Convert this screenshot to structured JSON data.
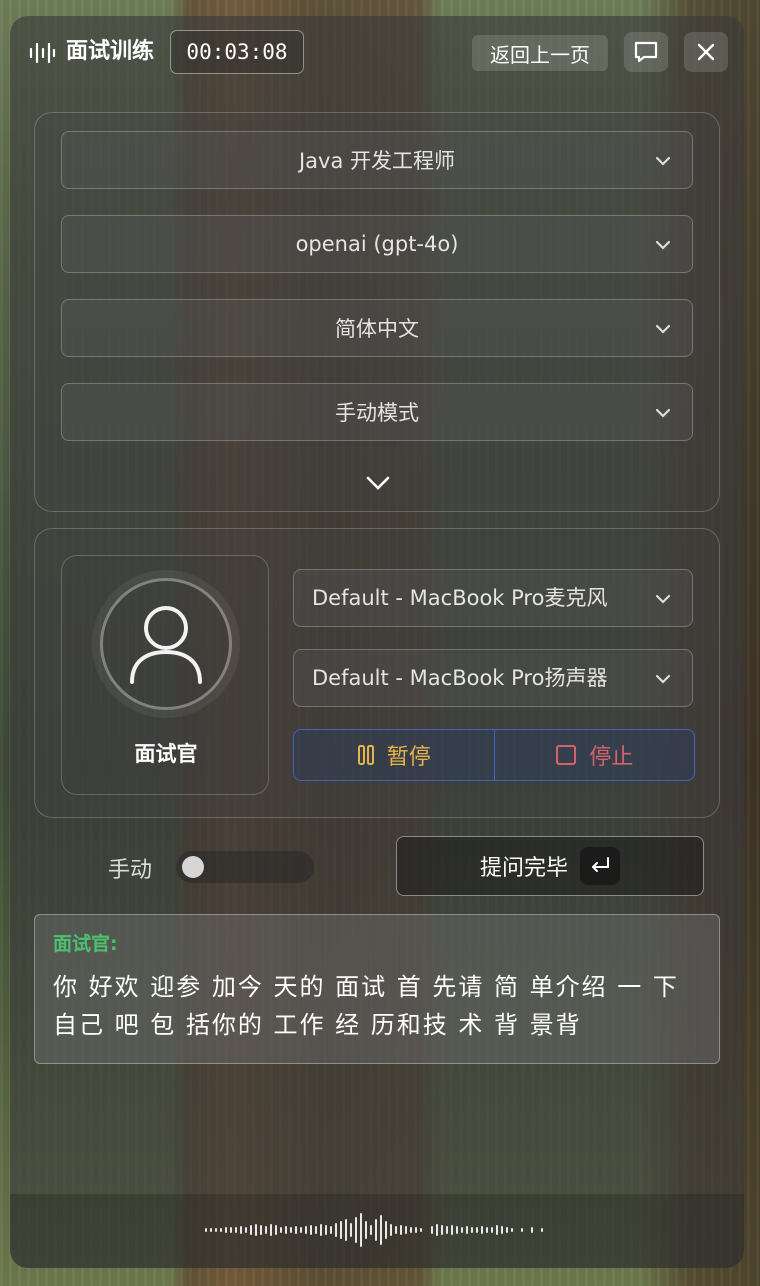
{
  "header": {
    "title": "面试训练",
    "timer": "00:03:08",
    "back_label": "返回上一页",
    "icons": {
      "logo": "waveform-icon",
      "chat": "chat-icon",
      "close": "close-icon"
    }
  },
  "settings": {
    "position": "Java 开发工程师",
    "model": "openai (gpt-4o)",
    "language": "简体中文",
    "mode": "手动模式"
  },
  "devices": {
    "avatar_label": "面试官",
    "microphone": "Default - MacBook Pro麦克风",
    "speaker": "Default - MacBook Pro扬声器",
    "pause_label": "暂停",
    "stop_label": "停止"
  },
  "mode_row": {
    "toggle_label": "手动",
    "toggle_on": false,
    "done_label": "提问完毕"
  },
  "transcript": {
    "speaker": "面试官:",
    "message": "你 好欢 迎参 加今 天的 面试 首 先请 简 单介绍 一 下 自己 吧 包 括你的 工作 经 历和技 术 背 景背"
  },
  "colors": {
    "accent_blue": "#3f66b8",
    "pause_color": "#e6b449",
    "stop_color": "#d9616b",
    "speaker_color": "#4cc26e"
  }
}
